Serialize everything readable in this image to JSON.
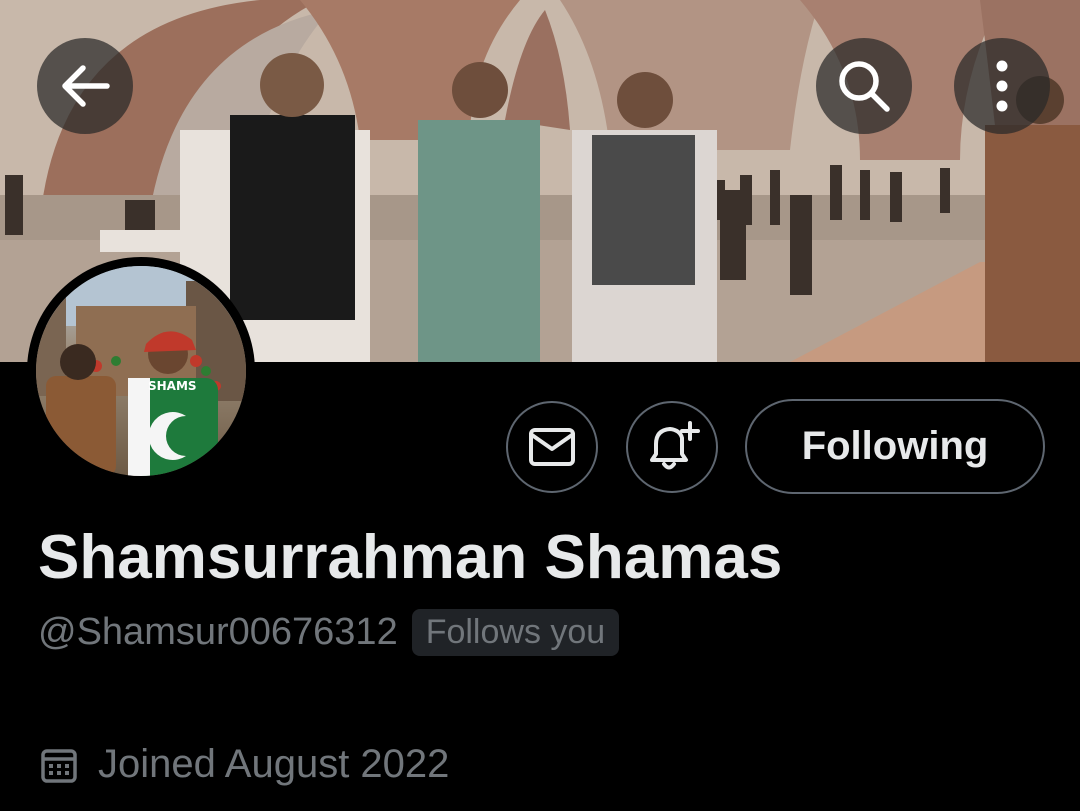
{
  "header": {
    "back_icon": "arrow-left-icon",
    "search_icon": "search-icon",
    "more_icon": "more-vertical-icon"
  },
  "profile": {
    "display_name": "Shamsurrahman Shamas",
    "handle": "@Shamsur00676312",
    "follows_you": "Follows you",
    "joined": "Joined August 2022",
    "avatar_shirt_text": "SHAMS"
  },
  "actions": {
    "message_icon": "mail-icon",
    "notify_icon": "bell-plus-icon",
    "following_label": "Following"
  },
  "colors": {
    "background": "#000000",
    "primary_text": "#e7e9ea",
    "secondary_text": "#71767b",
    "border": "#5e6670"
  }
}
